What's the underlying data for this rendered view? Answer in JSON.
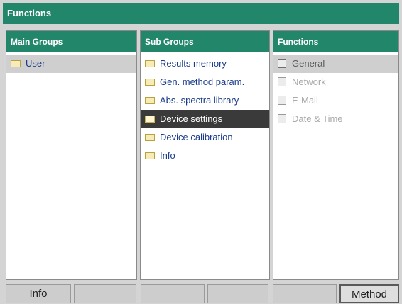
{
  "window": {
    "title": "Functions"
  },
  "panels": {
    "main_groups": {
      "header": "Main Groups",
      "items": [
        {
          "label": "User",
          "icon": "folder-icon"
        }
      ]
    },
    "sub_groups": {
      "header": "Sub Groups",
      "items": [
        {
          "label": "Results memory",
          "icon": "folder-icon"
        },
        {
          "label": "Gen. method param.",
          "icon": "folder-icon"
        },
        {
          "label": "Abs. spectra library",
          "icon": "folder-icon"
        },
        {
          "label": "Device settings",
          "icon": "folder-open-icon"
        },
        {
          "label": "Device calibration",
          "icon": "folder-icon"
        },
        {
          "label": "Info",
          "icon": "folder-icon"
        }
      ]
    },
    "functions": {
      "header": "Functions",
      "items": [
        {
          "label": "General",
          "icon": "page-icon"
        },
        {
          "label": "Network",
          "icon": "page-icon"
        },
        {
          "label": "E-Mail",
          "icon": "page-icon"
        },
        {
          "label": "Date & Time",
          "icon": "page-icon"
        }
      ]
    }
  },
  "softkeys": [
    "Info",
    "",
    "",
    "",
    "",
    "Method"
  ],
  "colors": {
    "accent": "#21866a",
    "selection": "#3a3a3a",
    "highlight": "#cfcfcf"
  }
}
